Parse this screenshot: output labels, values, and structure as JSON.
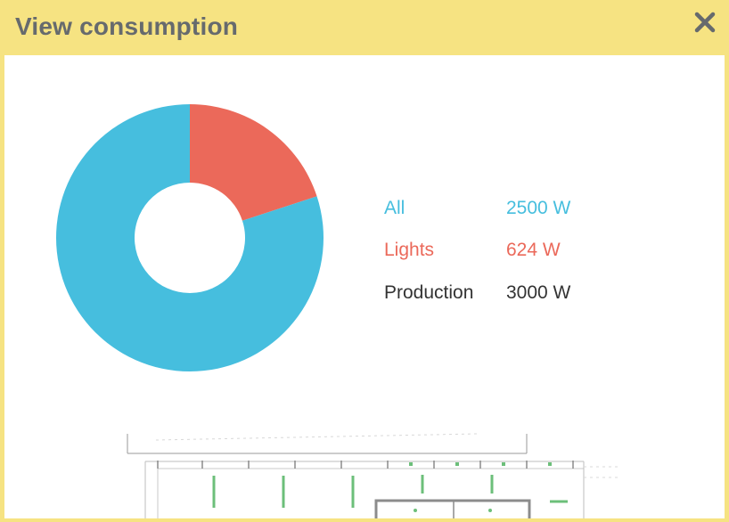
{
  "dialog": {
    "title": "View consumption",
    "close_icon": "close-icon"
  },
  "colors": {
    "titlebar": "#f6e382",
    "all": "#46bede",
    "lights": "#eb695a",
    "production": "#333333",
    "plan_lines": "#6cbf7a"
  },
  "chart_data": {
    "type": "pie",
    "style": "donut",
    "slices": [
      {
        "label": "Lights",
        "value": 624,
        "unit": "W",
        "color": "#eb695a"
      },
      {
        "label": "All",
        "value": 2500,
        "unit": "W",
        "color": "#46bede"
      }
    ]
  },
  "legend": [
    {
      "name": "All",
      "value": "2500 W",
      "color": "#46bede"
    },
    {
      "name": "Lights",
      "value": "624 W",
      "color": "#eb695a"
    },
    {
      "name": "Production",
      "value": "3000 W",
      "color": "#333333"
    }
  ]
}
